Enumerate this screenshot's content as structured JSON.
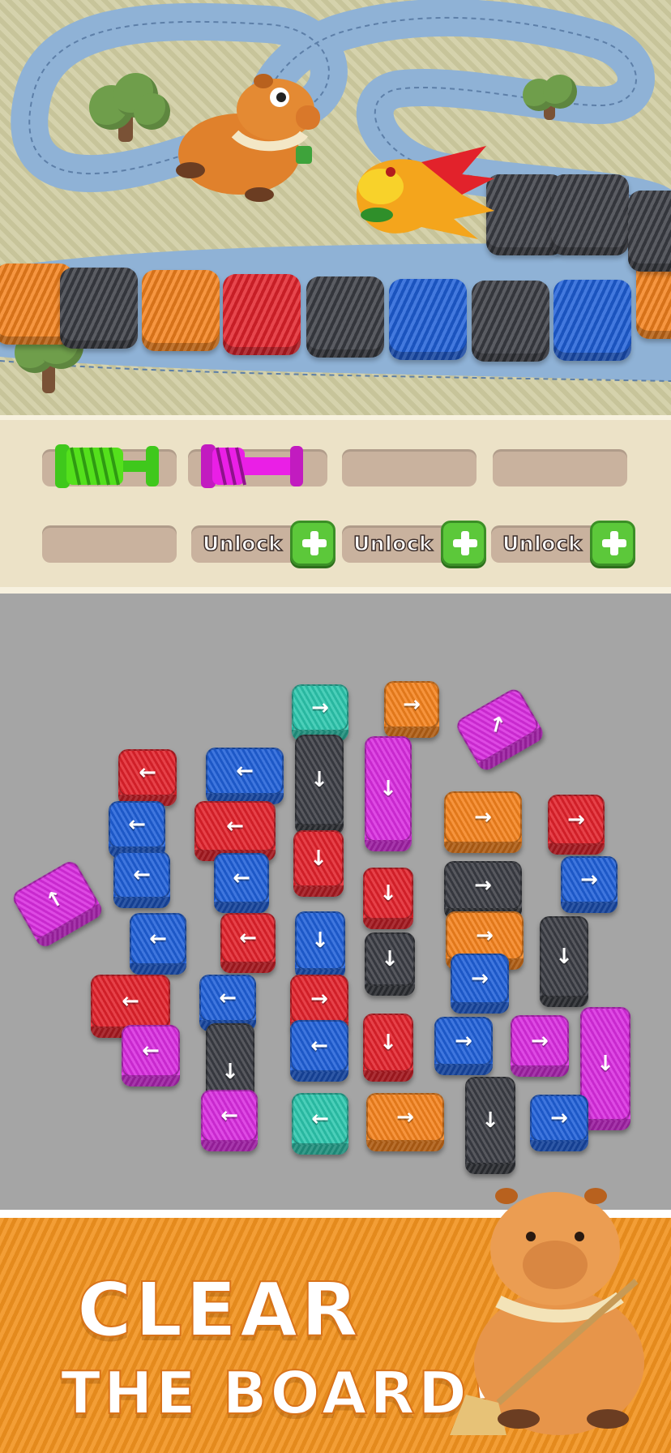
{
  "game_title": "",
  "spool_panel": {
    "slots": [
      {
        "state": "filled",
        "spool_color": "#54e01c"
      },
      {
        "state": "filled",
        "spool_color": "#ea1fe6"
      },
      {
        "state": "empty"
      },
      {
        "state": "empty"
      },
      {
        "state": "empty"
      }
    ],
    "unlock_slots": [
      {
        "label": "Unlock"
      },
      {
        "label": "Unlock"
      },
      {
        "label": "Unlock"
      }
    ]
  },
  "track_blocks": [
    "orange",
    "black",
    "orange",
    "red",
    "black",
    "blue",
    "black",
    "blue",
    "orange",
    "black",
    "black",
    "black"
  ],
  "board": {
    "tiles": [
      {
        "color": "teal",
        "dir": "right"
      },
      {
        "color": "orange",
        "dir": "right"
      },
      {
        "color": "magenta",
        "dir": "up-right"
      },
      {
        "color": "red",
        "dir": "left"
      },
      {
        "color": "blue",
        "dir": "left"
      },
      {
        "color": "black",
        "dir": "down"
      },
      {
        "color": "magenta",
        "dir": "down"
      },
      {
        "color": "blue",
        "dir": "left"
      },
      {
        "color": "red",
        "dir": "left"
      },
      {
        "color": "orange",
        "dir": "right"
      },
      {
        "color": "red",
        "dir": "right"
      },
      {
        "color": "blue",
        "dir": "left"
      },
      {
        "color": "blue",
        "dir": "left"
      },
      {
        "color": "red",
        "dir": "down"
      },
      {
        "color": "red",
        "dir": "down"
      },
      {
        "color": "black",
        "dir": "right"
      },
      {
        "color": "blue",
        "dir": "right"
      },
      {
        "color": "magenta",
        "dir": "up"
      },
      {
        "color": "blue",
        "dir": "left"
      },
      {
        "color": "red",
        "dir": "left"
      },
      {
        "color": "blue",
        "dir": "down"
      },
      {
        "color": "black",
        "dir": "down"
      },
      {
        "color": "orange",
        "dir": "right"
      },
      {
        "color": "black",
        "dir": "down"
      },
      {
        "color": "red",
        "dir": "left"
      },
      {
        "color": "blue",
        "dir": "left"
      },
      {
        "color": "red",
        "dir": "right"
      },
      {
        "color": "blue",
        "dir": "right"
      },
      {
        "color": "magenta",
        "dir": "left"
      },
      {
        "color": "black",
        "dir": "down"
      },
      {
        "color": "blue",
        "dir": "left"
      },
      {
        "color": "red",
        "dir": "down"
      },
      {
        "color": "blue",
        "dir": "right"
      },
      {
        "color": "magenta",
        "dir": "right"
      },
      {
        "color": "magenta",
        "dir": "down"
      },
      {
        "color": "magenta",
        "dir": "left"
      },
      {
        "color": "teal",
        "dir": "left"
      },
      {
        "color": "orange",
        "dir": "right"
      },
      {
        "color": "black",
        "dir": "down"
      },
      {
        "color": "blue",
        "dir": "right"
      }
    ]
  },
  "banner": {
    "line1": "CLEAR",
    "line2": "THE BOARD!"
  },
  "colors": {
    "red": "#e2222b",
    "blue": "#1f5fd8",
    "black": "#3b3d44",
    "orange": "#f4821d",
    "teal": "#2dc7ae",
    "magenta": "#d92ce0",
    "green": "#54e01c"
  }
}
